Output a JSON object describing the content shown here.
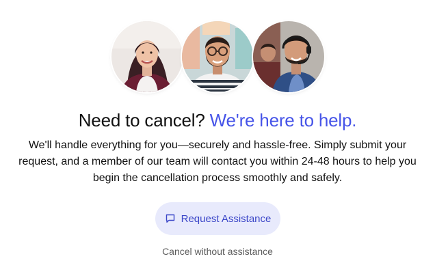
{
  "team_avatars": [
    {
      "name": "avatar-woman-smiling"
    },
    {
      "name": "avatar-man-beard-glasses"
    },
    {
      "name": "avatar-man-headset-support"
    }
  ],
  "headline": {
    "primary": "Need to cancel?",
    "accent": "We're here to help."
  },
  "description": "We'll handle everything for you—securely and hassle-free. Simply submit your request, and a member of our team will contact you within 24-48 hours to help you begin the cancellation process smoothly and safely.",
  "actions": {
    "request_label": "Request Assistance",
    "request_icon": "chat-bubble-icon",
    "cancel_label": "Cancel without assistance"
  },
  "colors": {
    "accent": "#4654e8",
    "button_bg": "#e8eafc",
    "button_text": "#3b46c8",
    "muted_text": "#5b5b5b"
  }
}
